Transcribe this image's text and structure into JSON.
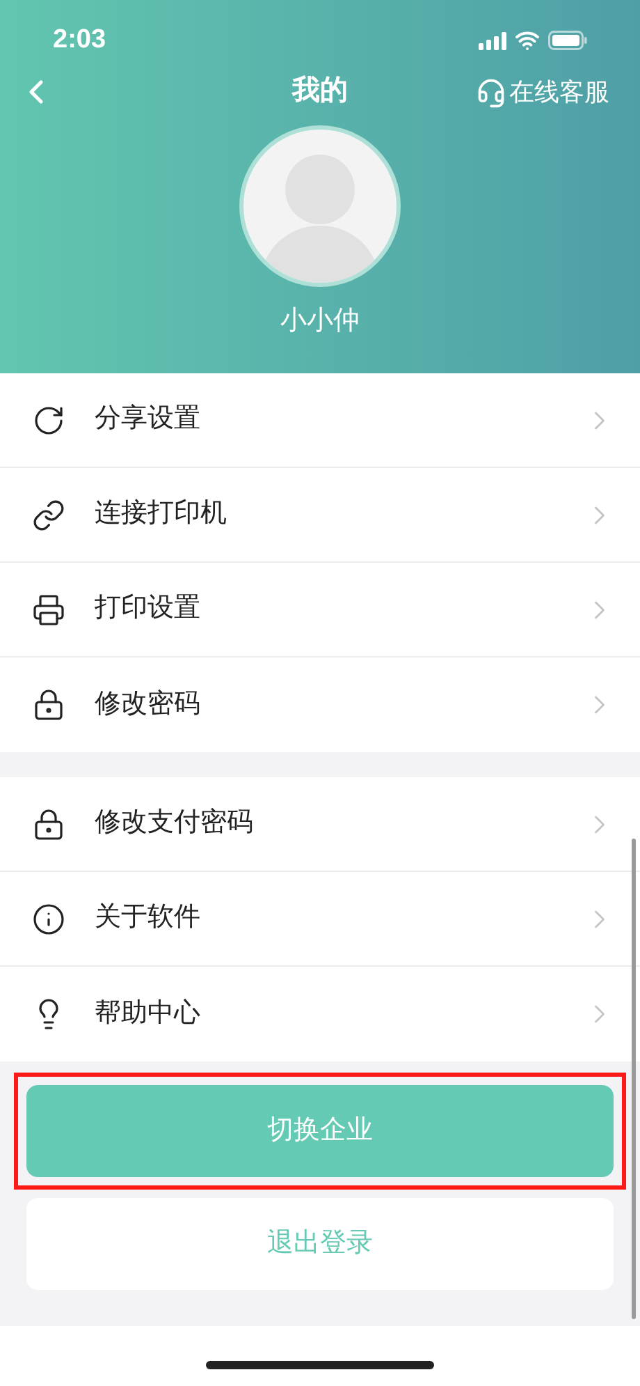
{
  "status_bar": {
    "time": "2:03"
  },
  "header": {
    "title": "我的",
    "service_link": "在线客服",
    "user_name": "小小仲"
  },
  "menu_groups": [
    [
      {
        "label": "分享设置"
      },
      {
        "label": "连接打印机"
      },
      {
        "label": "打印设置"
      },
      {
        "label": "修改密码"
      }
    ],
    [
      {
        "label": "修改支付密码"
      },
      {
        "label": "关于软件"
      },
      {
        "label": "帮助中心"
      }
    ]
  ],
  "buttons": [
    {
      "label": "切换企业",
      "kind": "primary",
      "highlighted": true
    },
    {
      "label": "退出登录",
      "kind": "secondary",
      "highlighted": false
    }
  ]
}
